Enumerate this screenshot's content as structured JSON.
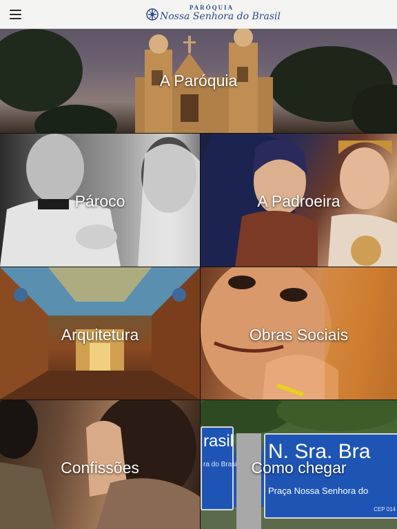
{
  "header": {
    "logo_top": "PARÓQUIA",
    "logo_main": "Nossa Senhora do Brasil"
  },
  "tiles": [
    {
      "label": "A Paróquia"
    },
    {
      "label": "Pároco"
    },
    {
      "label": "A Padroeira"
    },
    {
      "label": "Arquitetura"
    },
    {
      "label": "Obras Sociais"
    },
    {
      "label": "Confissões"
    },
    {
      "label": "Como chegar"
    }
  ],
  "street_sign": {
    "left_text": "rasil",
    "left_sub": "ra do Brasil",
    "main_text": "N. Sra. Bra",
    "sub_text": "Praça Nossa Senhora do",
    "cep": "CEP 014"
  },
  "colors": {
    "header_bg": "#f4f4f2",
    "logo_blue": "#2d4a86",
    "sign_blue": "#1e55b5"
  },
  "icons": [
    "hamburger-menu-icon",
    "parish-emblem-icon"
  ]
}
